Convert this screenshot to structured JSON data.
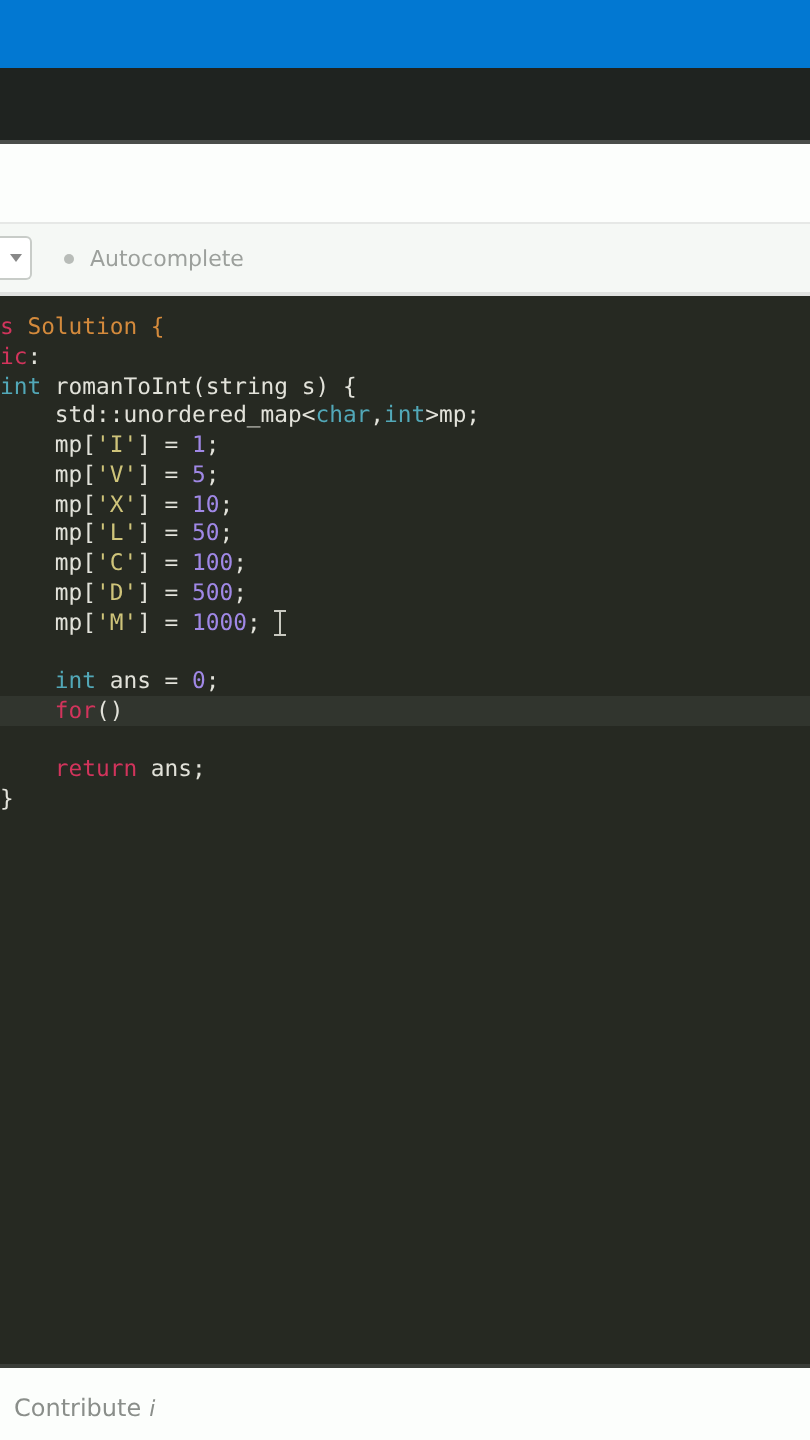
{
  "toolbar": {
    "autocomplete_label": "Autocomplete"
  },
  "editor": {
    "lines": [
      {
        "current": false,
        "indented": false,
        "gap_before": false,
        "tokens": [
          {
            "kind": "keyword",
            "text": "s"
          },
          {
            "kind": "class",
            "text": " Solution {"
          }
        ]
      },
      {
        "current": false,
        "indented": false,
        "gap_before": false,
        "tokens": [
          {
            "kind": "keyword",
            "text": "ic"
          },
          {
            "kind": "plain",
            "text": ":"
          }
        ]
      },
      {
        "current": false,
        "indented": false,
        "gap_before": false,
        "tokens": [
          {
            "kind": "type",
            "text": "int"
          },
          {
            "kind": "plain",
            "text": " romanToInt(string s) {"
          }
        ]
      },
      {
        "current": false,
        "indented": true,
        "gap_before": false,
        "tokens": [
          {
            "kind": "plain",
            "text": "std::unordered_map<"
          },
          {
            "kind": "type",
            "text": "char"
          },
          {
            "kind": "plain",
            "text": ","
          },
          {
            "kind": "type",
            "text": "int"
          },
          {
            "kind": "plain",
            "text": ">mp;"
          }
        ]
      },
      {
        "current": false,
        "indented": true,
        "gap_before": false,
        "tokens": [
          {
            "kind": "plain",
            "text": "mp["
          },
          {
            "kind": "string",
            "text": "'I'"
          },
          {
            "kind": "plain",
            "text": "] = "
          },
          {
            "kind": "number",
            "text": "1"
          },
          {
            "kind": "plain",
            "text": ";"
          }
        ]
      },
      {
        "current": false,
        "indented": true,
        "gap_before": false,
        "tokens": [
          {
            "kind": "plain",
            "text": "mp["
          },
          {
            "kind": "string",
            "text": "'V'"
          },
          {
            "kind": "plain",
            "text": "] = "
          },
          {
            "kind": "number",
            "text": "5"
          },
          {
            "kind": "plain",
            "text": ";"
          }
        ]
      },
      {
        "current": false,
        "indented": true,
        "gap_before": false,
        "tokens": [
          {
            "kind": "plain",
            "text": "mp["
          },
          {
            "kind": "string",
            "text": "'X'"
          },
          {
            "kind": "plain",
            "text": "] = "
          },
          {
            "kind": "number",
            "text": "10"
          },
          {
            "kind": "plain",
            "text": ";"
          }
        ]
      },
      {
        "current": false,
        "indented": true,
        "gap_before": false,
        "tokens": [
          {
            "kind": "plain",
            "text": "mp["
          },
          {
            "kind": "string",
            "text": "'L'"
          },
          {
            "kind": "plain",
            "text": "] = "
          },
          {
            "kind": "number",
            "text": "50"
          },
          {
            "kind": "plain",
            "text": ";"
          }
        ]
      },
      {
        "current": false,
        "indented": true,
        "gap_before": false,
        "tokens": [
          {
            "kind": "plain",
            "text": "mp["
          },
          {
            "kind": "string",
            "text": "'C'"
          },
          {
            "kind": "plain",
            "text": "] = "
          },
          {
            "kind": "number",
            "text": "100"
          },
          {
            "kind": "plain",
            "text": ";"
          }
        ]
      },
      {
        "current": false,
        "indented": true,
        "gap_before": false,
        "tokens": [
          {
            "kind": "plain",
            "text": "mp["
          },
          {
            "kind": "string",
            "text": "'D'"
          },
          {
            "kind": "plain",
            "text": "] = "
          },
          {
            "kind": "number",
            "text": "500"
          },
          {
            "kind": "plain",
            "text": ";"
          }
        ]
      },
      {
        "current": false,
        "indented": true,
        "gap_before": false,
        "mouse_cursor": true,
        "tokens": [
          {
            "kind": "plain",
            "text": "mp["
          },
          {
            "kind": "string",
            "text": "'M'"
          },
          {
            "kind": "plain",
            "text": "] = "
          },
          {
            "kind": "number",
            "text": "1000"
          },
          {
            "kind": "plain",
            "text": ";"
          }
        ]
      },
      {
        "current": false,
        "indented": true,
        "gap_before": true,
        "tokens": [
          {
            "kind": "type",
            "text": "int"
          },
          {
            "kind": "plain",
            "text": " ans = "
          },
          {
            "kind": "number",
            "text": "0"
          },
          {
            "kind": "plain",
            "text": ";"
          }
        ]
      },
      {
        "current": true,
        "indented": true,
        "gap_before": false,
        "tokens": [
          {
            "kind": "keyword",
            "text": "for"
          },
          {
            "kind": "plain",
            "text": "()"
          }
        ]
      },
      {
        "current": false,
        "indented": true,
        "gap_before": true,
        "tokens": [
          {
            "kind": "keyword",
            "text": "return"
          },
          {
            "kind": "plain",
            "text": " ans;"
          }
        ]
      },
      {
        "current": false,
        "indented": false,
        "gap_before": false,
        "tokens": [
          {
            "kind": "plain",
            "text": "}"
          }
        ]
      }
    ]
  },
  "footer": {
    "contribute_label": "Contribute",
    "info_mark": "i"
  }
}
